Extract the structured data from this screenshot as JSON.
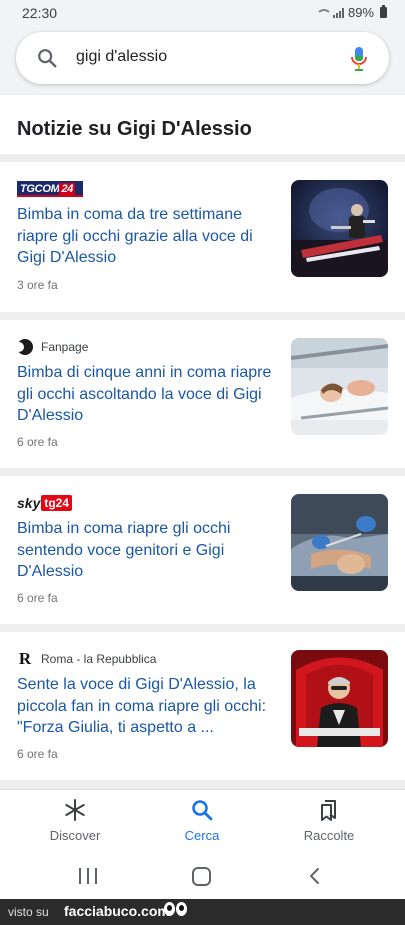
{
  "status_bar": {
    "time": "22:30",
    "battery": "89%"
  },
  "search": {
    "query": "gigi d'alessio"
  },
  "section": {
    "title": "Notizie su Gigi D'Alessio"
  },
  "articles": [
    {
      "source": "TGCOM24",
      "source_logo": "tgcom24-logo",
      "headline": "Bimba in coma da tre settimane riapre gli occhi grazie alla voce di Gigi D'Alessio",
      "time": "3 ore fa",
      "thumbnail": "concert-stage-photo"
    },
    {
      "source": "Fanpage",
      "source_logo": "fanpage-logo",
      "headline": "Bimba di cinque anni in coma riapre gli occhi ascoltando la voce di Gigi D'Alessio",
      "time": "6 ore fa",
      "thumbnail": "child-in-hospital-bed-photo"
    },
    {
      "source": "sky tg24",
      "source_logo": "skytg24-logo",
      "headline": "Bimba in coma riapre gli occhi sentendo voce genitori e Gigi D'Alessio",
      "time": "6 ore fa",
      "thumbnail": "hospital-care-photo"
    },
    {
      "source": "Roma - la Repubblica",
      "source_logo": "repubblica-logo",
      "headline": "Sente la voce di Gigi D'Alessio, la piccola fan in coma riapre gli occhi: \"Forza Giulia, ti aspetto a ...",
      "time": "6 ore fa",
      "thumbnail": "singer-red-chair-photo"
    }
  ],
  "bottom_nav": {
    "items": [
      {
        "label": "Discover",
        "icon": "discover-asterisk-icon",
        "active": false
      },
      {
        "label": "Cerca",
        "icon": "search-icon",
        "active": true
      },
      {
        "label": "Raccolte",
        "icon": "collections-icon",
        "active": false
      }
    ]
  },
  "watermark": {
    "prefix": "visto su",
    "site": "facciabuco.com"
  },
  "colors": {
    "link_blue": "#1a57a6",
    "active_blue": "#1a73e8",
    "header_bg": "#f1f3f4",
    "divider": "#eeeeee"
  }
}
